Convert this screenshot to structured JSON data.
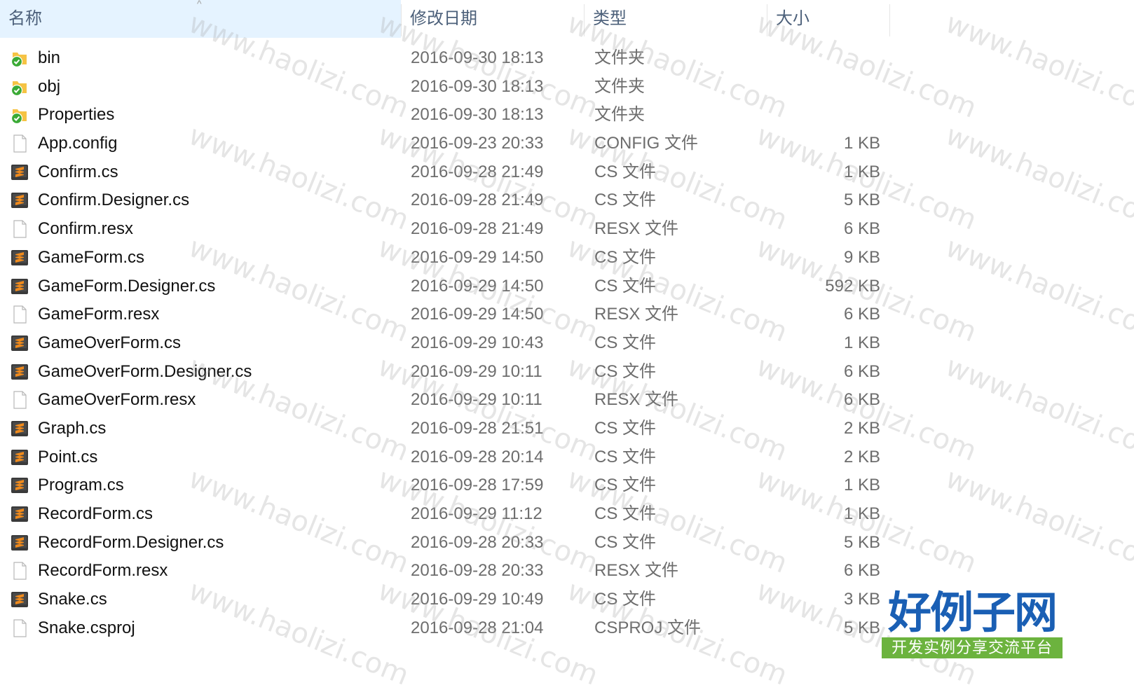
{
  "columns": {
    "name": "名称",
    "date": "修改日期",
    "type": "类型",
    "size": "大小"
  },
  "sort_indicator": "^",
  "files": [
    {
      "name": "bin",
      "date": "2016-09-30 18:13",
      "type": "文件夹",
      "size": "",
      "icon": "folder-synced-icon"
    },
    {
      "name": "obj",
      "date": "2016-09-30 18:13",
      "type": "文件夹",
      "size": "",
      "icon": "folder-synced-icon"
    },
    {
      "name": "Properties",
      "date": "2016-09-30 18:13",
      "type": "文件夹",
      "size": "",
      "icon": "folder-synced-icon"
    },
    {
      "name": "App.config",
      "date": "2016-09-23 20:33",
      "type": "CONFIG 文件",
      "size": "1 KB",
      "icon": "blank-file-icon"
    },
    {
      "name": "Confirm.cs",
      "date": "2016-09-28 21:49",
      "type": "CS 文件",
      "size": "1 KB",
      "icon": "sublime-file-icon"
    },
    {
      "name": "Confirm.Designer.cs",
      "date": "2016-09-28 21:49",
      "type": "CS 文件",
      "size": "5 KB",
      "icon": "sublime-file-icon"
    },
    {
      "name": "Confirm.resx",
      "date": "2016-09-28 21:49",
      "type": "RESX 文件",
      "size": "6 KB",
      "icon": "blank-file-icon"
    },
    {
      "name": "GameForm.cs",
      "date": "2016-09-29 14:50",
      "type": "CS 文件",
      "size": "9 KB",
      "icon": "sublime-file-icon"
    },
    {
      "name": "GameForm.Designer.cs",
      "date": "2016-09-29 14:50",
      "type": "CS 文件",
      "size": "592 KB",
      "icon": "sublime-file-icon"
    },
    {
      "name": "GameForm.resx",
      "date": "2016-09-29 14:50",
      "type": "RESX 文件",
      "size": "6 KB",
      "icon": "blank-file-icon"
    },
    {
      "name": "GameOverForm.cs",
      "date": "2016-09-29 10:43",
      "type": "CS 文件",
      "size": "1 KB",
      "icon": "sublime-file-icon"
    },
    {
      "name": "GameOverForm.Designer.cs",
      "date": "2016-09-29 10:11",
      "type": "CS 文件",
      "size": "6 KB",
      "icon": "sublime-file-icon"
    },
    {
      "name": "GameOverForm.resx",
      "date": "2016-09-29 10:11",
      "type": "RESX 文件",
      "size": "6 KB",
      "icon": "blank-file-icon"
    },
    {
      "name": "Graph.cs",
      "date": "2016-09-28 21:51",
      "type": "CS 文件",
      "size": "2 KB",
      "icon": "sublime-file-icon"
    },
    {
      "name": "Point.cs",
      "date": "2016-09-28 20:14",
      "type": "CS 文件",
      "size": "2 KB",
      "icon": "sublime-file-icon"
    },
    {
      "name": "Program.cs",
      "date": "2016-09-28 17:59",
      "type": "CS 文件",
      "size": "1 KB",
      "icon": "sublime-file-icon"
    },
    {
      "name": "RecordForm.cs",
      "date": "2016-09-29 11:12",
      "type": "CS 文件",
      "size": "1 KB",
      "icon": "sublime-file-icon"
    },
    {
      "name": "RecordForm.Designer.cs",
      "date": "2016-09-28 20:33",
      "type": "CS 文件",
      "size": "5 KB",
      "icon": "sublime-file-icon"
    },
    {
      "name": "RecordForm.resx",
      "date": "2016-09-28 20:33",
      "type": "RESX 文件",
      "size": "6 KB",
      "icon": "blank-file-icon"
    },
    {
      "name": "Snake.cs",
      "date": "2016-09-29 10:49",
      "type": "CS 文件",
      "size": "3 KB",
      "icon": "sublime-file-icon"
    },
    {
      "name": "Snake.csproj",
      "date": "2016-09-28 21:04",
      "type": "CSPROJ 文件",
      "size": "5 KB",
      "icon": "blank-file-icon"
    }
  ],
  "watermark_text": "www.haolizi.com",
  "logo": {
    "title": "好例子网",
    "subtitle": "开发实例分享交流平台"
  },
  "colors": {
    "header_text": "#4c607a",
    "secondary_text": "#6d6d6d",
    "sync_green": "#3aaa35",
    "folder_yellow": "#f5c344",
    "sublime_orange": "#f08a1c",
    "logo_blue": "#1a5fb4",
    "logo_green": "#6cb33e"
  }
}
